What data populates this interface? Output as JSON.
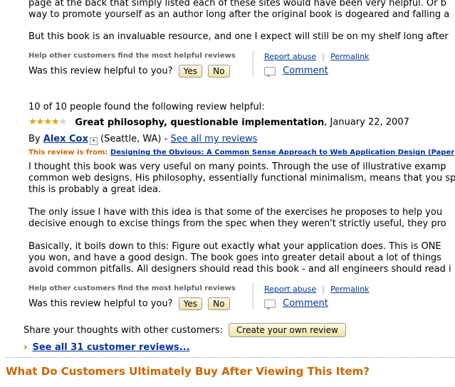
{
  "review_prev": {
    "line1": "page at the back that simply listed each of these sites would have been very helpful. Or b",
    "line2": "way to promote yourself as an author long after the original book is dogeared and falling a",
    "line3": "But this book is an invaluable resource, and one I expect will still be on my shelf long after",
    "help_others": "Help other customers find the most helpful reviews",
    "was_helpful": "Was this review helpful to you?",
    "yes": "Yes",
    "no": "No",
    "report_abuse": "Report abuse",
    "permalink": "Permalink",
    "comment": "Comment",
    "pipe": "|"
  },
  "review": {
    "helpful_count": "10 of 10 people found the following review helpful:",
    "rating": 4,
    "title": "Great philosophy, questionable implementation",
    "date": ", January 22, 2007",
    "by": "By",
    "author": "Alex Cox",
    "location": "(Seattle, WA)",
    "dash": "-",
    "see_all": "See all my reviews",
    "review_from_label": "This review is from:",
    "product": "Designing the Obvious: A Common Sense Approach to Web Application Design (Paper",
    "body": [
      "I thought this book was very useful on many points. Through the use of illustrative examp",
      "common web designs. His philosophy, essentially functional minimalism, means that you sp",
      "this is probably a great idea.",
      "The only issue I have with this idea is that some of the exercises he proposes to help you",
      "decisive enough to excise things from the spec when they weren't strictly useful, they pro",
      "Basically, it boils down to this: Figure out exactly what your application does. This is ONE",
      "you won, and have a good design. The book goes into greater detail about a lot of things",
      "avoid common pitfalls. All designers should read this book - and all engineers should read i"
    ],
    "help_others": "Help other customers find the most helpful reviews",
    "was_helpful": "Was this review helpful to you?",
    "yes": "Yes",
    "no": "No",
    "report_abuse": "Report abuse",
    "permalink": "Permalink",
    "comment": "Comment",
    "pipe": "|"
  },
  "footer": {
    "share_text": "Share your thoughts with other customers:",
    "create_review": "Create your own review",
    "see_all_reviews": "See all 31 customer reviews...",
    "arrow": "›",
    "section_heading": "What Do Customers Ultimately Buy After Viewing This Item?"
  },
  "colors": {
    "link": "#003399",
    "star": "#e3a20b",
    "heading": "#cc6600"
  }
}
